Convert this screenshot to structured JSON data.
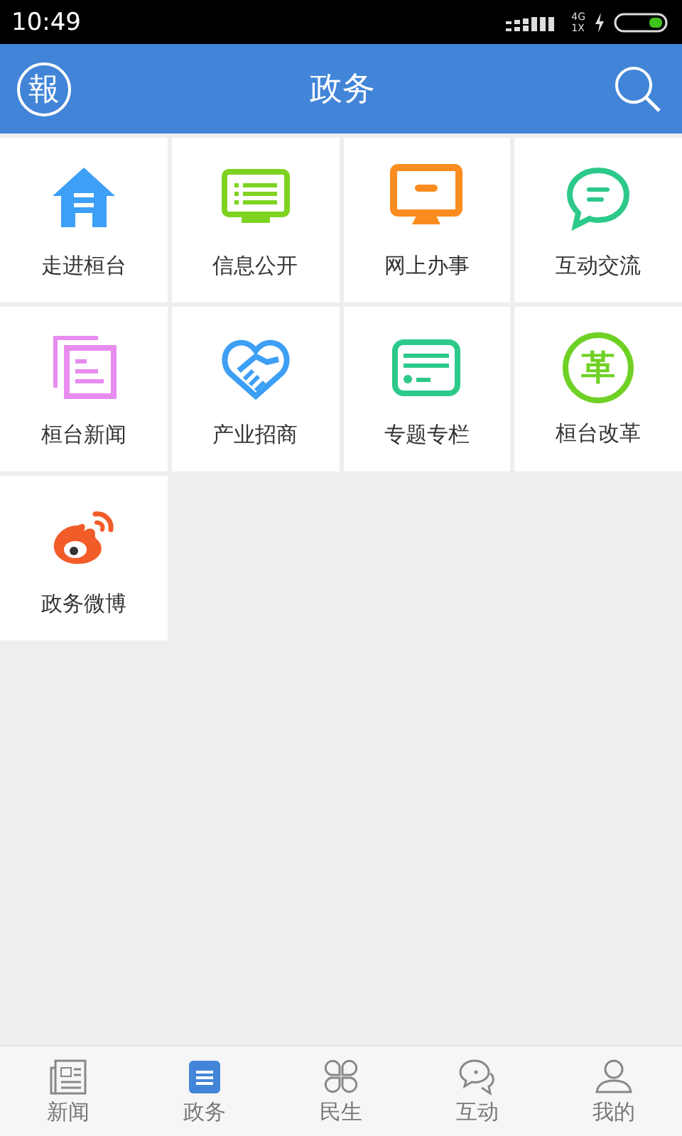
{
  "status_bar": {
    "time": "10:49",
    "network_top": "4G",
    "network_bottom": "1X"
  },
  "header": {
    "logo": "報",
    "title": "政务"
  },
  "tiles": [
    {
      "label": "走进桓台"
    },
    {
      "label": "信息公开"
    },
    {
      "label": "网上办事"
    },
    {
      "label": "互动交流"
    },
    {
      "label": "桓台新闻"
    },
    {
      "label": "产业招商"
    },
    {
      "label": "专题专栏"
    },
    {
      "label": "桓台改革",
      "glyph": "革"
    },
    {
      "label": "政务微博"
    }
  ],
  "tabs": [
    {
      "label": "新闻",
      "selected": false
    },
    {
      "label": "政务",
      "selected": true
    },
    {
      "label": "民生",
      "selected": false
    },
    {
      "label": "互动",
      "selected": false
    },
    {
      "label": "我的",
      "selected": false
    }
  ]
}
